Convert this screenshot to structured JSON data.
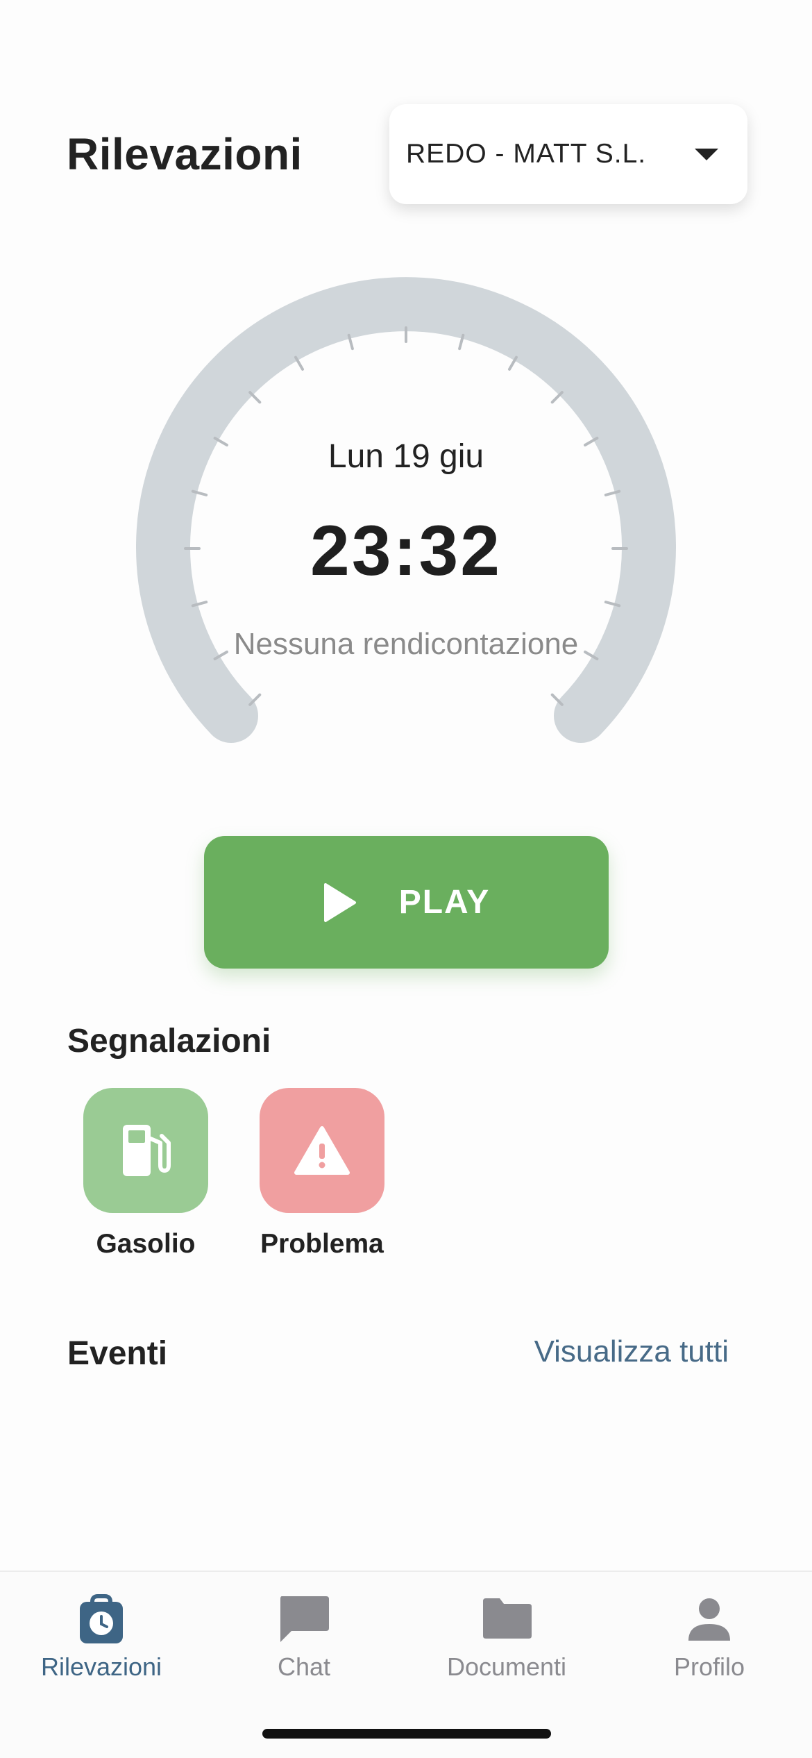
{
  "header": {
    "title": "Rilevazioni"
  },
  "company_select": {
    "value": "REDO - MATT S.L.",
    "icon": "chevron-down-icon"
  },
  "gauge": {
    "date": "Lun 19 giu",
    "time": "23:32",
    "status": "Nessuna rendicontazione",
    "track_color": "#d0d6da",
    "tick_color": "#b8bcc0"
  },
  "play": {
    "label": "PLAY",
    "icon": "play-icon",
    "color": "#6aaf5e"
  },
  "reports": {
    "title": "Segnalazioni",
    "items": [
      {
        "label": "Gasolio",
        "icon": "fuel-pump-icon",
        "color": "#9acb94"
      },
      {
        "label": "Problema",
        "icon": "warning-icon",
        "color": "#f09fa0"
      }
    ]
  },
  "events": {
    "title": "Eventi",
    "view_all": "Visualizza tutti"
  },
  "tabbar": {
    "items": [
      {
        "label": "Rilevazioni",
        "icon": "time-bag-icon",
        "active": true
      },
      {
        "label": "Chat",
        "icon": "chat-icon",
        "active": false
      },
      {
        "label": "Documenti",
        "icon": "folder-icon",
        "active": false
      },
      {
        "label": "Profilo",
        "icon": "person-icon",
        "active": false
      }
    ]
  },
  "colors": {
    "accent": "#3e6585",
    "link": "#476a87",
    "inactive": "#8a8a8f"
  }
}
